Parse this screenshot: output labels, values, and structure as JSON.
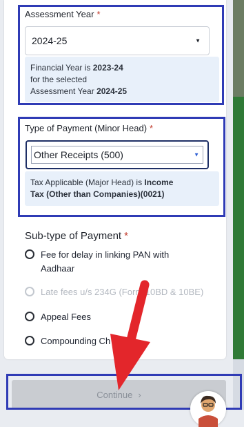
{
  "assessment_year": {
    "label": "Assessment Year",
    "required_mark": "*",
    "selected_value": "2024-25",
    "info_line1": "Financial Year is ",
    "info_fy": "2023-24",
    "info_line2": "for the selected",
    "info_line3": "Assessment Year ",
    "info_ay": "2024-25"
  },
  "type_of_payment": {
    "label": "Type of Payment (Minor Head)",
    "required_mark": "*",
    "selected_value": "Other Receipts (500)",
    "info_prefix": "Tax Applicable (Major Head) is ",
    "info_bold_1": "Income",
    "info_bold_2": "Tax (Other than Companies)(0021)"
  },
  "subtype_of_payment": {
    "label": "Sub-type of Payment",
    "required_mark": "*",
    "options": [
      {
        "line1": "Fee for delay in linking PAN with",
        "line2": "Aadhaar",
        "disabled": false
      },
      {
        "line1": "Late fees u/s 234G (Form 10BD & 10BE)",
        "disabled": true
      },
      {
        "line1": "Appeal Fees",
        "disabled": false
      },
      {
        "line1": "Compounding Ch",
        "disabled": false
      }
    ]
  },
  "continue_button": {
    "label": "Continue",
    "icon": "chevron-right-icon"
  },
  "colors": {
    "highlight_border": "#2f3bb5",
    "arrow_red": "#e3262b",
    "info_bg": "#e8f0fa",
    "required": "#c0392b"
  }
}
